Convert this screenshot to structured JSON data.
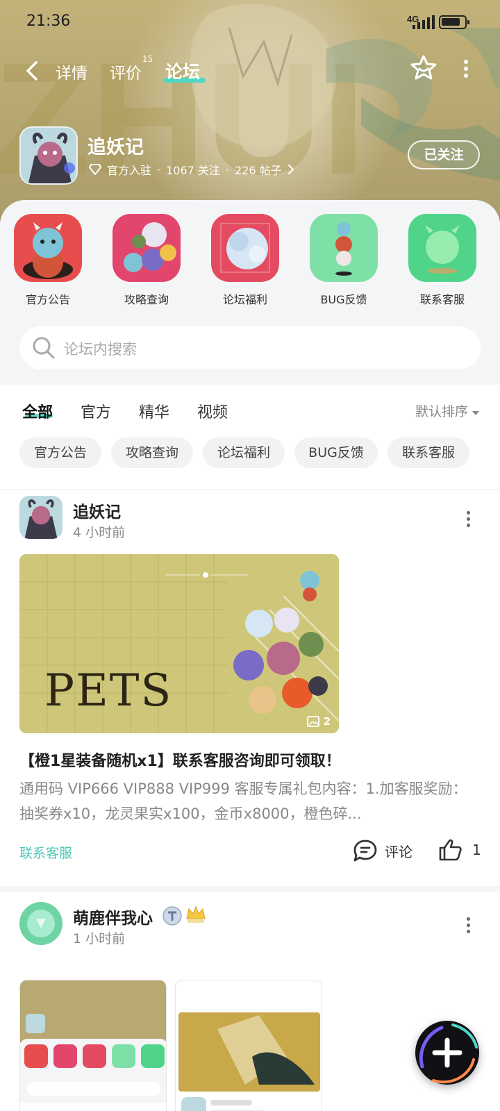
{
  "status_bar": {
    "time": "21:36",
    "network": "4G",
    "battery_level": 0.85
  },
  "nav": {
    "tabs": [
      {
        "label": "详情",
        "active": false
      },
      {
        "label": "评价",
        "badge": "15",
        "active": false
      },
      {
        "label": "论坛",
        "active": true
      }
    ]
  },
  "game": {
    "title": "追妖记",
    "official_label": "官方入驻",
    "followers": "1067 关注",
    "posts": "226 帖子",
    "follow_label": "已关注"
  },
  "shortcuts": [
    {
      "label": "官方公告"
    },
    {
      "label": "攻略查询"
    },
    {
      "label": "论坛福利"
    },
    {
      "label": "BUG反馈"
    },
    {
      "label": "联系客服"
    }
  ],
  "search": {
    "placeholder": "论坛内搜索"
  },
  "filters": {
    "tabs": [
      "全部",
      "官方",
      "精华",
      "视频"
    ],
    "active": "全部",
    "sort_label": "默认排序"
  },
  "chips": [
    "官方公告",
    "攻略查询",
    "论坛福利",
    "BUG反馈",
    "联系客服"
  ],
  "posts": [
    {
      "author": "追妖记",
      "time": "4 小时前",
      "image_count": "2",
      "image_text": "PETS",
      "title": "【橙1星装备随机x1】联系客服咨询即可领取！",
      "body": "通用码 VIP666 VIP888 VIP999 客服专属礼包内容：1.加客服奖励：抽奖券x10，龙灵果实x100，金币x8000，橙色碎...",
      "tag": "联系客服",
      "comment_label": "评论",
      "likes": "1"
    },
    {
      "author": "萌鹿伴我心",
      "time": "1 小时前"
    }
  ],
  "colors": {
    "accent": "#4fd6c4",
    "tag": "#4fc6b7",
    "banner": "#b8a872"
  }
}
